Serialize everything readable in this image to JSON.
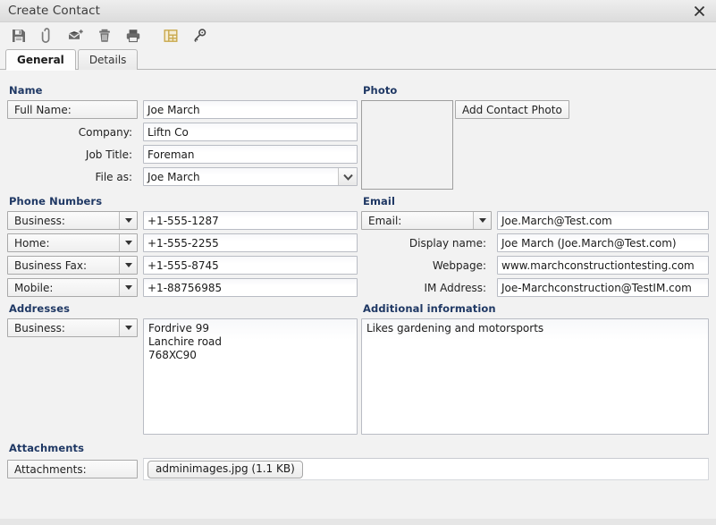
{
  "window": {
    "title": "Create Contact",
    "close_icon": "close-icon"
  },
  "toolbar": {
    "buttons": [
      {
        "name": "save-button",
        "icon": "save-floppy-icon",
        "label": "Save"
      },
      {
        "name": "attach-button",
        "icon": "paperclip-icon",
        "label": "Attach"
      },
      {
        "name": "new-mail-button",
        "icon": "envelope-plus-icon",
        "label": "New Mail"
      },
      {
        "name": "delete-button",
        "icon": "trash-icon",
        "label": "Delete"
      },
      {
        "name": "print-button",
        "icon": "printer-icon",
        "label": "Print"
      },
      {
        "name": "layout-button",
        "icon": "form-layout-icon",
        "label": "Layout"
      },
      {
        "name": "permissions-button",
        "icon": "key-icon",
        "label": "Permissions"
      }
    ]
  },
  "tabs": [
    {
      "label": "General",
      "active": true
    },
    {
      "label": "Details",
      "active": false
    }
  ],
  "sections": {
    "name": {
      "title": "Name",
      "full_name_label": "Full Name:",
      "full_name_value": "Joe March",
      "company_label": "Company:",
      "company_value": "Liftn Co",
      "job_title_label": "Job Title:",
      "job_title_value": "Foreman",
      "file_as_label": "File as:",
      "file_as_value": "Joe March"
    },
    "photo": {
      "title": "Photo",
      "add_photo_label": "Add Contact Photo"
    },
    "phone": {
      "title": "Phone Numbers",
      "rows": [
        {
          "type": "Business:",
          "value": "+1-555-1287"
        },
        {
          "type": "Home:",
          "value": "+1-555-2255"
        },
        {
          "type": "Business Fax:",
          "value": "+1-555-8745"
        },
        {
          "type": "Mobile:",
          "value": "+1-88756985"
        }
      ]
    },
    "email": {
      "title": "Email",
      "email_type": "Email:",
      "email_value": "Joe.March@Test.com",
      "display_name_label": "Display name:",
      "display_name_value": "Joe March (Joe.March@Test.com)",
      "webpage_label": "Webpage:",
      "webpage_value": "www.marchconstructiontesting.com",
      "im_label": "IM Address:",
      "im_value": "Joe-Marchconstruction@TestIM.com"
    },
    "addresses": {
      "title": "Addresses",
      "type": "Business:",
      "value": "Fordrive 99\nLanchire road\n768XC90"
    },
    "additional": {
      "title": "Additional information",
      "value": "Likes gardening and motorsports"
    },
    "attachments": {
      "title": "Attachments",
      "label": "Attachments:",
      "files": [
        {
          "name": "adminimages.jpg (1.1 KB)"
        }
      ]
    }
  },
  "colors": {
    "window_bg": "#f2f2f2",
    "titlebar": "#e4e4e4",
    "section_heading": "#1f3864",
    "accent_icon": "#c9a84c",
    "field_border": "#b9bcc4"
  }
}
